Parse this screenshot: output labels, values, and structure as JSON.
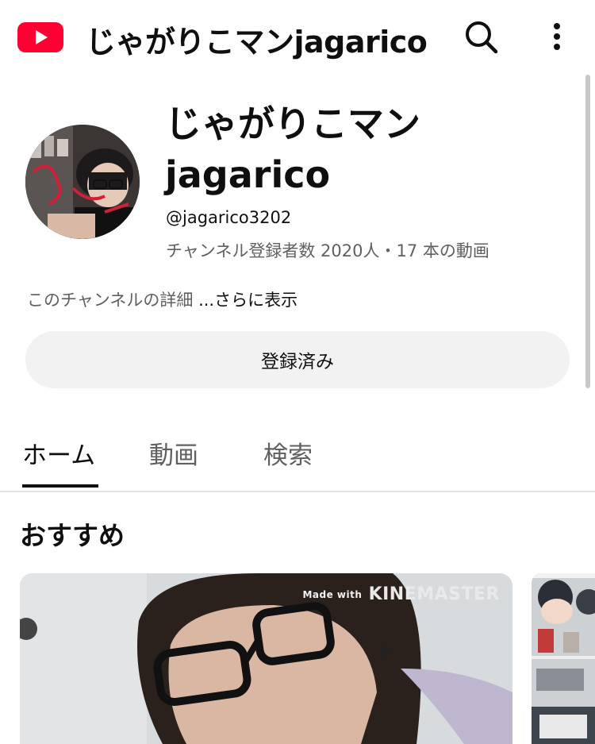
{
  "header": {
    "title": "じゃがりこマンjagarico",
    "logo_icon": "youtube-logo",
    "search_icon": "search-icon",
    "more_icon": "more-vert-icon"
  },
  "channel": {
    "name": "じゃがりこマン jagarico",
    "handle": "@jagarico3202",
    "subscribers": "チャンネル登録者数 2020人",
    "separator": "・",
    "videos": "17 本の動画",
    "description": "このチャンネルの詳細",
    "more_label": "...さらに表示",
    "subscribe_label": "登録済み"
  },
  "tabs": [
    {
      "label": "ホーム",
      "active": true
    },
    {
      "label": "動画",
      "active": false
    },
    {
      "label": "検索",
      "active": false
    }
  ],
  "section": {
    "title": "おすすめ",
    "watermark_small": "Made with",
    "watermark_brand": "KINEMASTER"
  },
  "colors": {
    "brand": "#ff0033",
    "text": "#0f0f0f",
    "secondary_text": "#606060",
    "button_bg": "#f2f2f2"
  }
}
